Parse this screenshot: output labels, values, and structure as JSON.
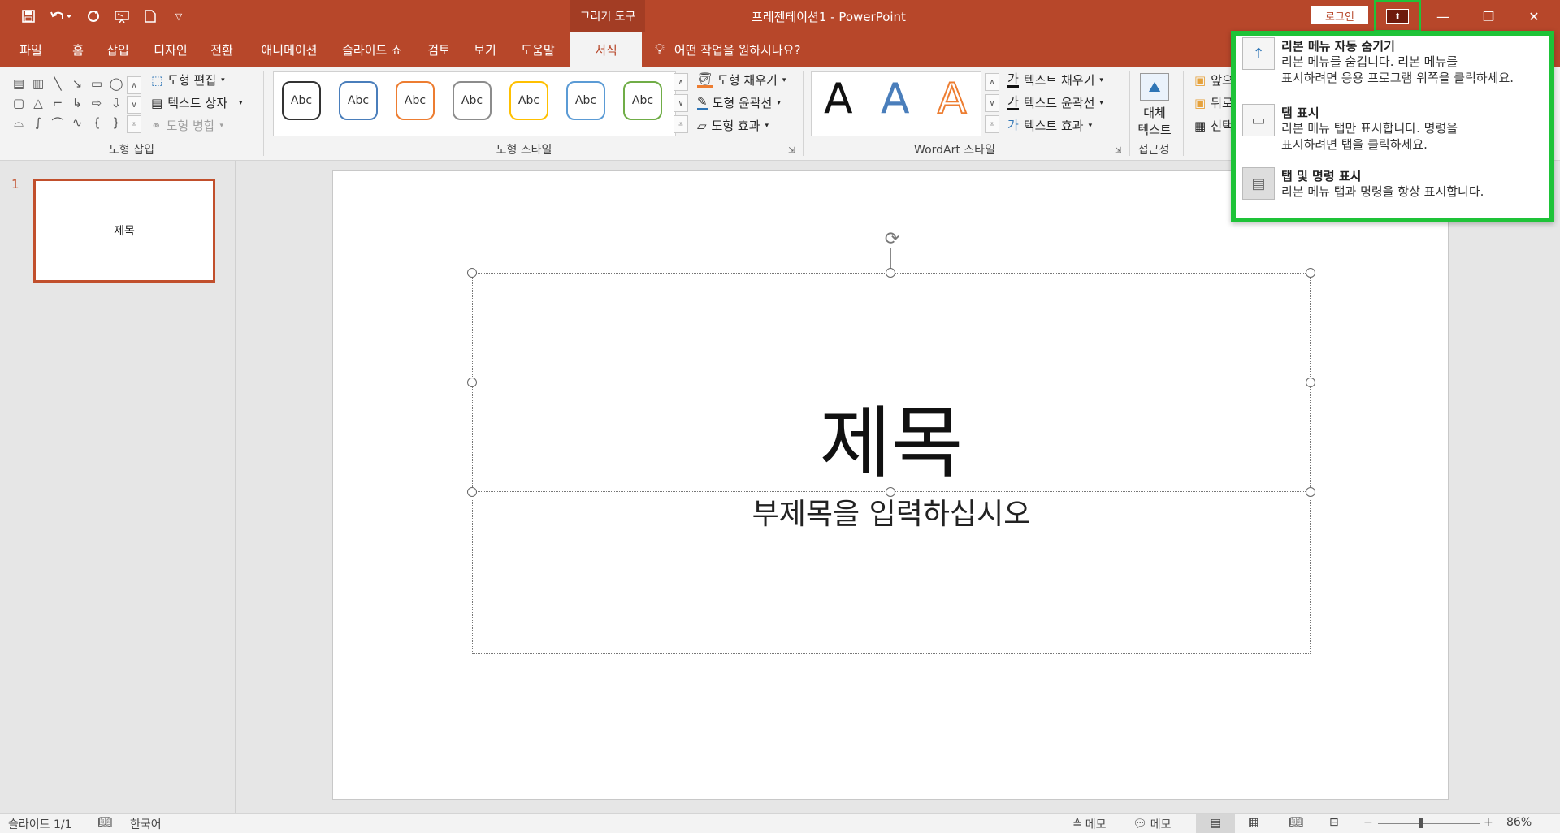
{
  "titlebar": {
    "contextual_tab": "그리기 도구",
    "doc_title": "프레젠테이션1  -  PowerPoint",
    "login": "로그인"
  },
  "tabs": [
    {
      "label": "파일"
    },
    {
      "label": "홈"
    },
    {
      "label": "삽입"
    },
    {
      "label": "디자인"
    },
    {
      "label": "전환"
    },
    {
      "label": "애니메이션"
    },
    {
      "label": "슬라이드 쇼"
    },
    {
      "label": "검토"
    },
    {
      "label": "보기"
    },
    {
      "label": "도움말"
    },
    {
      "label": "서식"
    }
  ],
  "tellme": "어떤 작업을 원하시나요?",
  "ribbon": {
    "insert_shapes": {
      "label": "도형 삽입",
      "edit_shape": "도형 편집",
      "text_box": "텍스트 상자",
      "merge_shapes": "도형 병합"
    },
    "shape_styles": {
      "label": "도형 스타일",
      "swatch_text": "Abc",
      "swatch_colors": [
        "#333333",
        "#4a7ebb",
        "#ed7d31",
        "#8c8c8c",
        "#ffc000",
        "#5b9bd5",
        "#70ad47"
      ],
      "fill": "도형 채우기",
      "outline": "도형 윤곽선",
      "effects": "도형 효과"
    },
    "wordart": {
      "label": "WordArt 스타일",
      "letter": "A",
      "text_fill": "텍스트 채우기",
      "text_outline": "텍스트 윤곽선",
      "text_effects": "텍스트 효과",
      "text_fill_icon": "가",
      "text_outline_icon": "가",
      "text_effects_icon": "가"
    },
    "accessibility": {
      "label": "접근성",
      "alt_text_line1": "대체",
      "alt_text_line2": "텍스트"
    },
    "arrange": {
      "bring_forward": "앞으",
      "send_backward": "뒤로",
      "selection": "선택"
    }
  },
  "popup": {
    "items": [
      {
        "title": "리본 메뉴 자동 숨기기",
        "desc1": "리본 메뉴를 숨깁니다. 리본 메뉴를",
        "desc2": "표시하려면 응용 프로그램 위쪽을 클릭하세요."
      },
      {
        "title": "탭 표시",
        "desc1": "리본 메뉴 탭만 표시합니다. 명령을",
        "desc2": "표시하려면 탭을 클릭하세요."
      },
      {
        "title": "탭 및 명령 표시",
        "desc1": "리본 메뉴 탭과 명령을 항상 표시합니다.",
        "desc2": ""
      }
    ]
  },
  "slides_panel": {
    "number": "1",
    "thumb_title": "제목"
  },
  "slide": {
    "title": "제목",
    "subtitle": "부제목을 입력하십시오"
  },
  "statusbar": {
    "slide_count": "슬라이드 1/1",
    "language": "한국어",
    "notes": "메모",
    "comments": "메모",
    "zoom": "86%",
    "zoom_level": 86
  }
}
